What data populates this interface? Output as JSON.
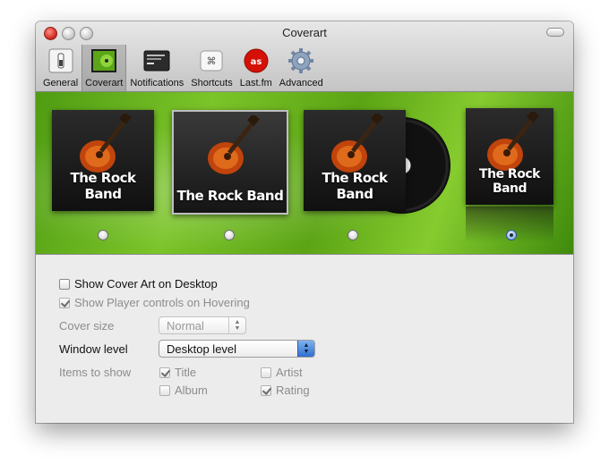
{
  "window": {
    "title": "Coverart"
  },
  "toolbar": {
    "items": [
      {
        "label": "General",
        "icon": "general-switch-icon"
      },
      {
        "label": "Coverart",
        "icon": "coverart-icon",
        "selected": true
      },
      {
        "label": "Notifications",
        "icon": "notifications-icon"
      },
      {
        "label": "Shortcuts",
        "icon": "command-key-icon"
      },
      {
        "label": "Last.fm",
        "icon": "lastfm-icon"
      },
      {
        "label": "Advanced",
        "icon": "gear-icon"
      }
    ]
  },
  "covers": {
    "band_name": "The Rock Band",
    "styles": [
      {
        "style": "flat",
        "selected": false
      },
      {
        "style": "jewel-case",
        "selected": false
      },
      {
        "style": "vinyl",
        "selected": false
      },
      {
        "style": "reflection",
        "selected": true
      }
    ]
  },
  "options": {
    "show_cover_art": {
      "label": "Show Cover Art on Desktop",
      "checked": false
    },
    "show_player_controls": {
      "label": "Show Player controls on Hovering",
      "checked": true,
      "disabled": true
    }
  },
  "cover_size": {
    "label": "Cover size",
    "value": "Normal"
  },
  "window_level": {
    "label": "Window level",
    "value": "Desktop level"
  },
  "items_to_show": {
    "label": "Items to show",
    "title": {
      "label": "Title",
      "checked": true
    },
    "artist": {
      "label": "Artist",
      "checked": false
    },
    "album": {
      "label": "Album",
      "checked": false
    },
    "rating": {
      "label": "Rating",
      "checked": true
    }
  },
  "colors": {
    "banner_green": "#6cb520",
    "accent_blue": "#2f6fd0"
  }
}
